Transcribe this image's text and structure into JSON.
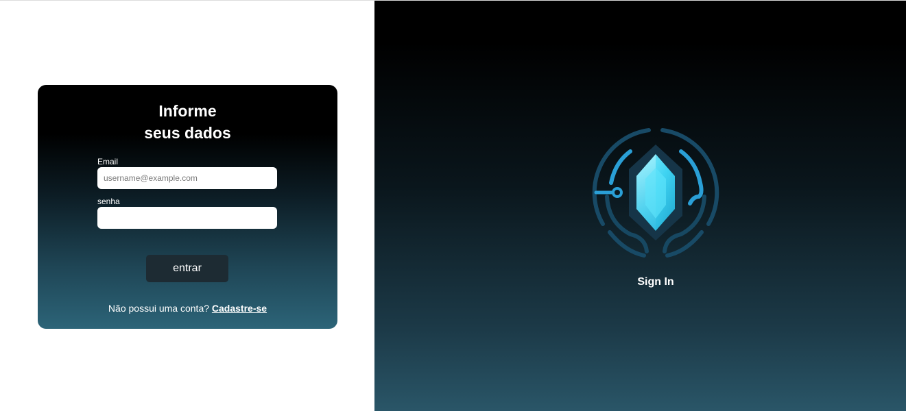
{
  "login_card": {
    "title_line1": "Informe",
    "title_line2": "seus dados",
    "email_label": "Email",
    "email_placeholder": "username@example.com",
    "email_value": "",
    "password_label": "senha",
    "password_value": "",
    "submit_label": "entrar",
    "signup_prompt": "Não possui uma conta?",
    "signup_link": "Cadastre-se"
  },
  "brand_panel": {
    "logo_icon": "crystal-circuit-logo-icon",
    "caption": "Sign In"
  },
  "colors": {
    "card_gradient_top": "#000000",
    "card_gradient_bottom": "#2c6478",
    "button_bg": "#1d2b33",
    "logo_cyan": "#35c9ee",
    "logo_ring": "#1b5f86"
  }
}
